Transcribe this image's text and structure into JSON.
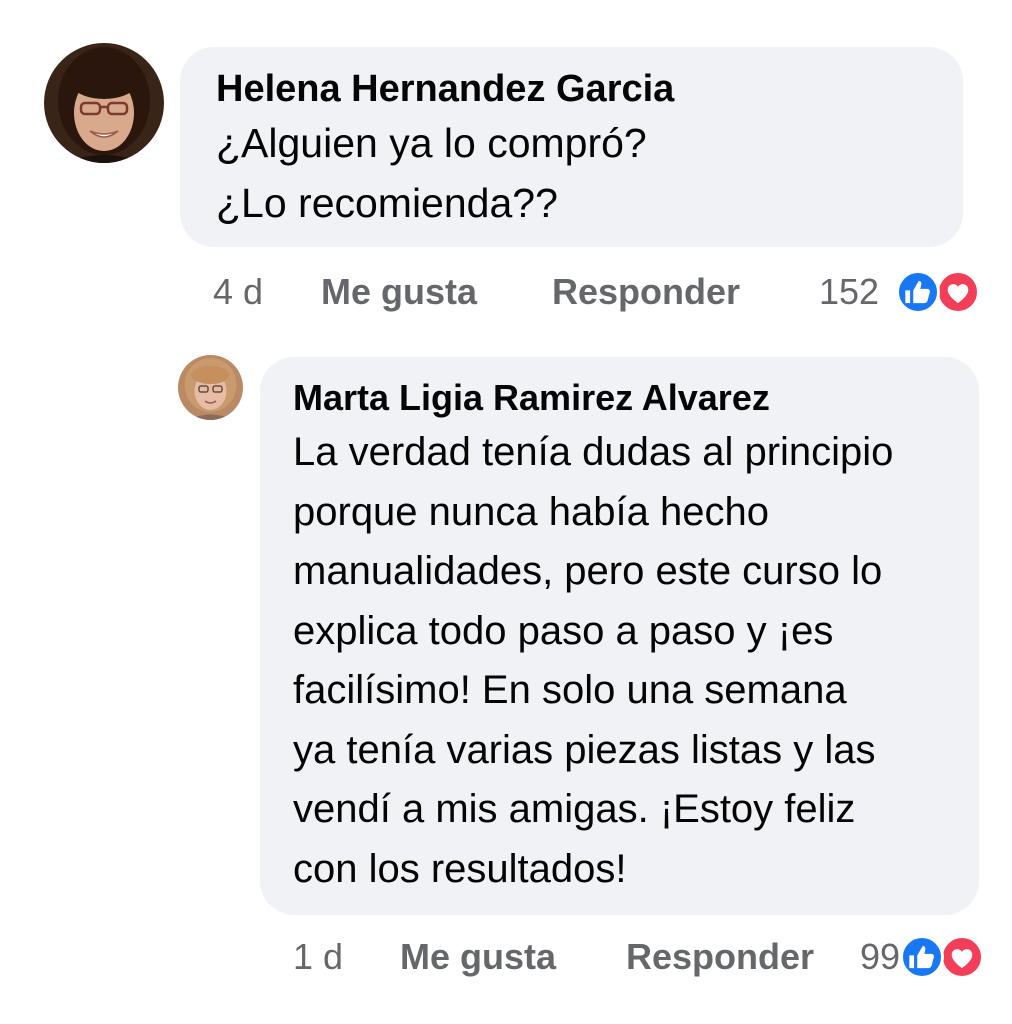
{
  "comments": [
    {
      "author": "Helena Hernandez Garcia",
      "lines": [
        "¿Alguien ya lo compró?",
        "¿Lo recomienda??"
      ],
      "time": "4 d",
      "like_label": "Me gusta",
      "reply_label": "Responder",
      "reaction_count": "152",
      "reactions": [
        "like-icon",
        "love-icon"
      ]
    },
    {
      "author": "Marta Ligia Ramirez Alvarez",
      "lines": [
        "La verdad tenía dudas al principio",
        "porque nunca había hecho",
        "manualidades, pero este curso lo",
        "explica todo paso a paso y ¡es",
        "facilísimo! En solo una semana",
        "ya tenía varias piezas listas y las",
        "vendí a mis amigas. ¡Estoy feliz",
        "con los resultados!"
      ],
      "time": "1 d",
      "like_label": "Me gusta",
      "reply_label": "Responder",
      "reaction_count": "99",
      "reactions": [
        "like-icon",
        "love-icon"
      ]
    }
  ],
  "colors": {
    "bubble": "#f0f2f5",
    "meta_text": "#65676b",
    "like": "#1877f2",
    "love": "#f33e58"
  }
}
